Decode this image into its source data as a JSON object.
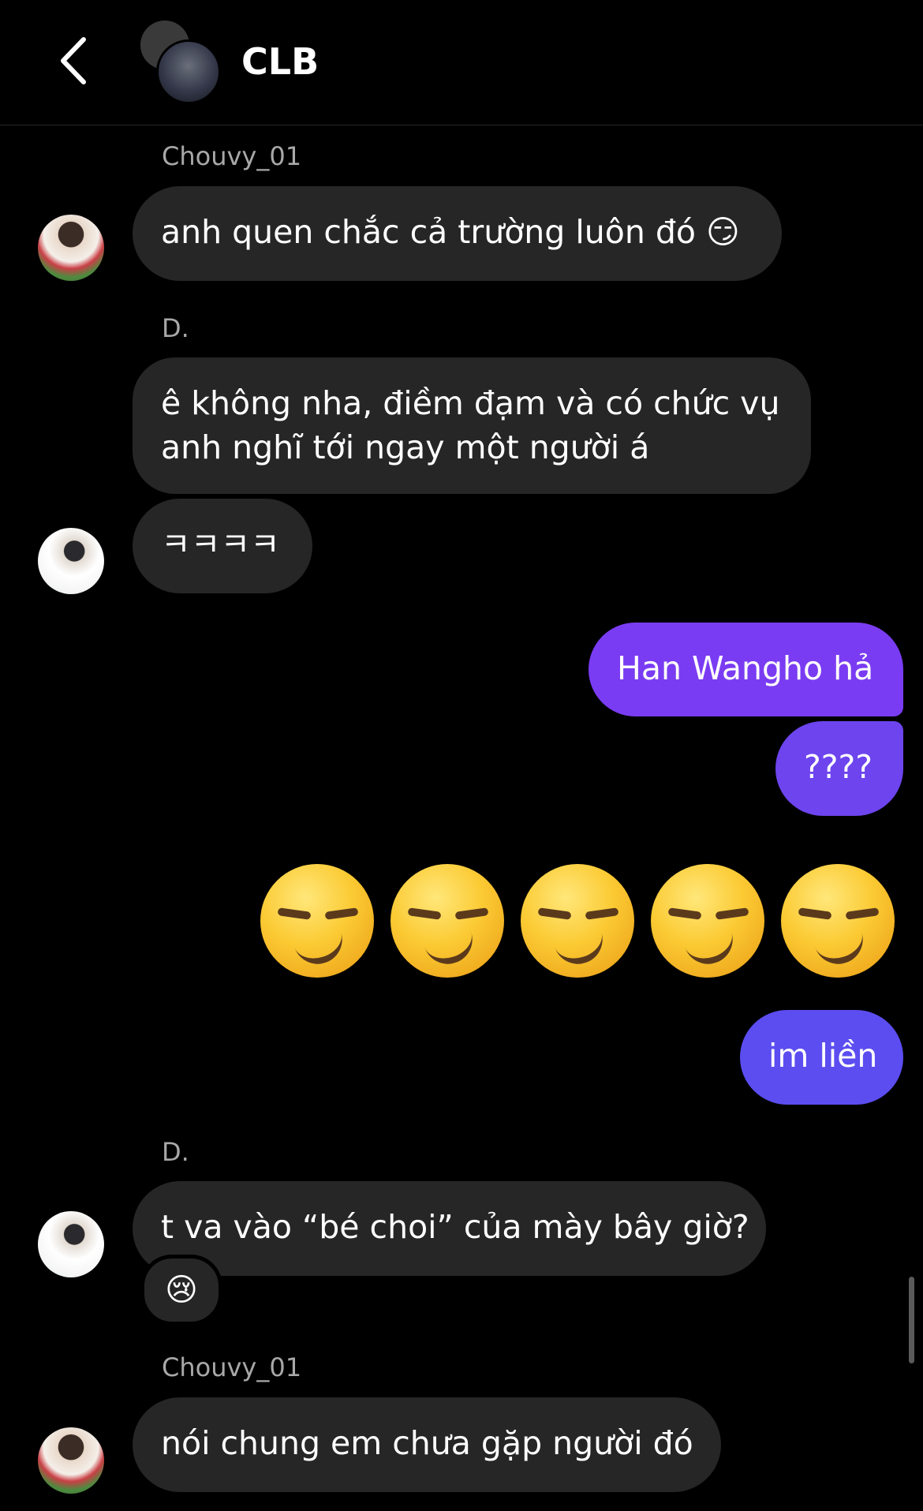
{
  "header": {
    "title": "CLB"
  },
  "messages": [
    {
      "sender": "Chouvy_01",
      "text": "anh quen chắc cả trường luôn đó 😏"
    },
    {
      "sender": "D.",
      "line1": "ê không nha, điềm đạm và có chức vụ",
      "line2": "anh nghĩ tới ngay một người á"
    },
    {
      "text": "ㅋㅋㅋㅋ"
    },
    {
      "text": "Han Wangho hả"
    },
    {
      "text": "????"
    },
    {
      "text": "im liền"
    },
    {
      "sender": "D.",
      "text": "t va vào “bé choi” của mày bây giờ?",
      "reaction": "😢"
    },
    {
      "sender": "Chouvy_01",
      "text": "nói chung em chưa gặp người đó"
    }
  ],
  "big_emoji": {
    "icon": "smirking-face-emoji",
    "count": 5
  },
  "colors": {
    "bubble_other": "#262626",
    "bubble_me_top": "#7a3cf2",
    "bubble_me_bottom": "#5b4df0"
  }
}
